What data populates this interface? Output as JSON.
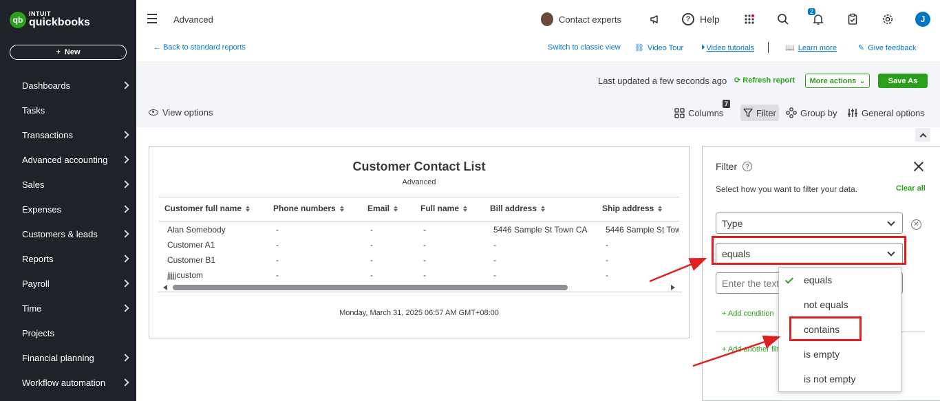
{
  "sidebar": {
    "logo": {
      "brand_top": "INTUIT",
      "brand_bottom": "quickbooks",
      "mark": "qb"
    },
    "new_button": "New",
    "items": [
      {
        "label": "Dashboards",
        "has_chevron": true
      },
      {
        "label": "Tasks",
        "has_chevron": false
      },
      {
        "label": "Transactions",
        "has_chevron": true
      },
      {
        "label": "Advanced accounting",
        "has_chevron": true
      },
      {
        "label": "Sales",
        "has_chevron": true
      },
      {
        "label": "Expenses",
        "has_chevron": true
      },
      {
        "label": "Customers & leads",
        "has_chevron": true
      },
      {
        "label": "Reports",
        "has_chevron": true
      },
      {
        "label": "Payroll",
        "has_chevron": true
      },
      {
        "label": "Time",
        "has_chevron": true
      },
      {
        "label": "Projects",
        "has_chevron": false
      },
      {
        "label": "Financial planning",
        "has_chevron": true
      },
      {
        "label": "Workflow automation",
        "has_chevron": true
      }
    ]
  },
  "header": {
    "title": "Advanced",
    "contact_experts": "Contact experts",
    "help": "Help",
    "notification_count": "2",
    "user_initial": "J"
  },
  "links": {
    "back": "Back to standard reports",
    "switch_classic": "Switch to classic view",
    "video_tour": "Video Tour",
    "video_tutorials": "Video tutorials",
    "learn_more": "Learn more",
    "give_feedback": "Give feedback"
  },
  "toolbar": {
    "last_updated": "Last updated a few seconds ago",
    "refresh": "Refresh report",
    "more_actions": "More actions",
    "save_as": "Save As",
    "view_options": "View options",
    "columns": "Columns",
    "columns_badge": "7",
    "filter": "Filter",
    "group_by": "Group by",
    "general_options": "General options"
  },
  "report": {
    "title": "Customer Contact List",
    "subtitle": "Advanced",
    "columns": [
      "Customer full name",
      "Phone numbers",
      "Email",
      "Full name",
      "Bill address",
      "Ship address"
    ],
    "rows": [
      [
        "Alan Somebody",
        "-",
        "-",
        "-",
        "5446 Sample St Town CA",
        "5446 Sample St Tow"
      ],
      [
        "Customer A1",
        "-",
        "-",
        "-",
        "-",
        "-"
      ],
      [
        "Customer B1",
        "-",
        "-",
        "-",
        "-",
        "-"
      ],
      [
        "jjjjjcustom",
        "-",
        "-",
        "-",
        "-",
        "-"
      ]
    ],
    "date": "Monday, March 31, 2025 06:57 AM GMT+08:00"
  },
  "filter_panel": {
    "title": "Filter",
    "description": "Select how you want to filter your data.",
    "clear_all": "Clear all",
    "field_select": "Type",
    "operator_select": "equals",
    "text_placeholder": "Enter the text",
    "add_condition": "+ Add condition",
    "add_another_filter": "+ Add another filter"
  },
  "operator_menu": {
    "selected": "equals",
    "options": [
      "equals",
      "not equals",
      "contains",
      "is empty",
      "is not empty"
    ]
  },
  "colors": {
    "sidebar_bg": "#1f2329",
    "brand_green": "#2ca01c",
    "link_blue": "#0077c5",
    "annotation_red": "#e02020"
  }
}
